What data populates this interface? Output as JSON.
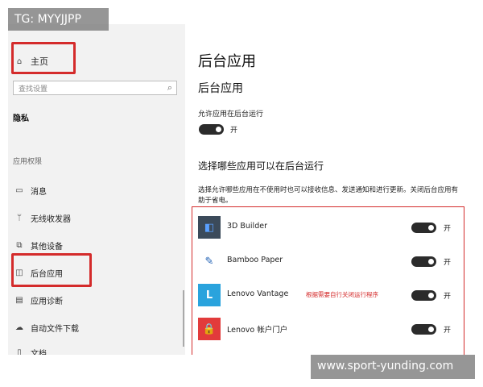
{
  "watermark_top_left": "TG: MYYJJPP",
  "watermark_bottom_right": "www.sport-yunding.com",
  "sidebar": {
    "home_label": "主页",
    "search_placeholder": "查找设置",
    "category": "隐私",
    "section_title": "应用权限",
    "items": [
      {
        "label": "消息",
        "icon": "message-icon"
      },
      {
        "label": "无线收发器",
        "icon": "radio-icon"
      },
      {
        "label": "其他设备",
        "icon": "devices-icon"
      },
      {
        "label": "后台应用",
        "icon": "background-apps-icon"
      },
      {
        "label": "应用诊断",
        "icon": "diagnostics-icon"
      },
      {
        "label": "自动文件下载",
        "icon": "cloud-download-icon"
      },
      {
        "label": "文档",
        "icon": "document-icon"
      }
    ]
  },
  "main": {
    "title": "后台应用",
    "subtitle": "后台应用",
    "allow_label": "允许应用在后台运行",
    "allow_state": "开",
    "choose_title": "选择哪些应用可以在后台运行",
    "description": "选择允许哪些应用在不使用时也可以接收信息、发送通知和进行更新。关闭后台应用有助于省电。",
    "annotation": "根据需要自行关闭运行程序",
    "apps": [
      {
        "name": "3D Builder",
        "state": "开",
        "icon": "3d-builder-icon"
      },
      {
        "name": "Bamboo Paper",
        "state": "开",
        "icon": "bamboo-paper-icon"
      },
      {
        "name": "Lenovo Vantage",
        "state": "开",
        "icon": "lenovo-vantage-icon"
      },
      {
        "name": "Lenovo 帐户门户",
        "state": "开",
        "icon": "lenovo-account-icon"
      }
    ]
  },
  "colors": {
    "highlight": "#d42b2b",
    "toggle_on": "#2b2b2b",
    "sidebar_bg": "#f2f2f2"
  }
}
